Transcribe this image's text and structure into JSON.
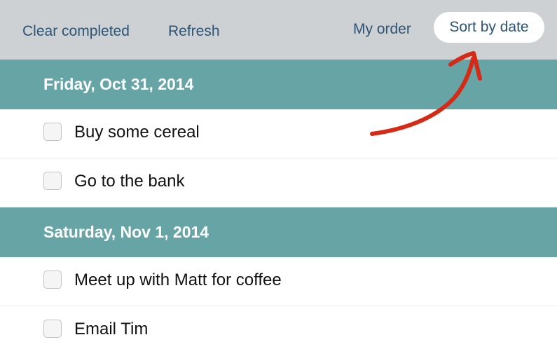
{
  "toolbar": {
    "clear_completed": "Clear completed",
    "refresh": "Refresh",
    "my_order": "My order",
    "sort_by_date": "Sort by date"
  },
  "groups": [
    {
      "date": "Friday, Oct 31, 2014",
      "tasks": [
        {
          "text": "Buy some cereal",
          "done": false
        },
        {
          "text": "Go to the bank",
          "done": false
        }
      ]
    },
    {
      "date": "Saturday, Nov 1, 2014",
      "tasks": [
        {
          "text": "Meet up with Matt for coffee",
          "done": false
        },
        {
          "text": "Email Tim",
          "done": false
        }
      ]
    }
  ],
  "colors": {
    "toolbar_bg": "#cdd1d4",
    "header_bg": "#67a4a6",
    "link": "#2c5475",
    "annotation_arrow": "#d42a16"
  },
  "annotation": {
    "icon": "red-arrow-icon"
  }
}
